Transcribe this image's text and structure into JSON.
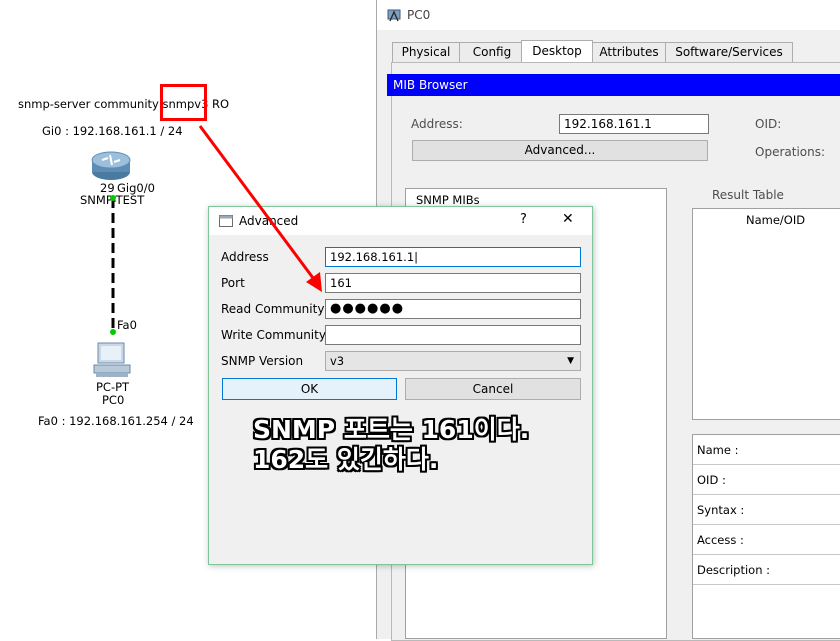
{
  "topology": {
    "server_command": "snmp-server community snmpv3 RO",
    "router_ip": "Gi0 : 192.168.161.1 / 24",
    "router_port_number": "29",
    "router_port_name": "Gig0/0",
    "router_name": "SNMP-TEST",
    "pc_port": "Fa0",
    "pc_type": "PC-PT",
    "pc_name": "PC0",
    "pc_ip": "Fa0 : 192.168.161.254 / 24"
  },
  "pc_window": {
    "title": "PC0",
    "tabs": [
      {
        "label": "Physical"
      },
      {
        "label": "Config"
      },
      {
        "label": "Desktop"
      },
      {
        "label": "Attributes"
      },
      {
        "label": "Software/Services"
      }
    ],
    "active_tab": "Desktop",
    "mib_browser": {
      "title": "MIB Browser",
      "address_label": "Address:",
      "address_value": "192.168.161.1",
      "oid_label": "OID:",
      "operations_label": "Operations:",
      "advanced_button": "Advanced...",
      "snmp_mibs_title": "SNMP MIBs",
      "result_table_label": "Result Table",
      "name_oid_header": "Name/OID",
      "details": [
        {
          "label": "Name :"
        },
        {
          "label": "OID :"
        },
        {
          "label": "Syntax :"
        },
        {
          "label": "Access :"
        },
        {
          "label": "Description :"
        }
      ]
    }
  },
  "advanced_dialog": {
    "title": "Advanced",
    "help_glyph": "?",
    "close_glyph": "✕",
    "address_label": "Address",
    "address_value": "192.168.161.1|",
    "port_label": "Port",
    "port_value": "161",
    "read_community_label": "Read Community",
    "read_community_masked": "●●●●●●",
    "write_community_label": "Write Community",
    "write_community_value": "",
    "snmp_version_label": "SNMP Version",
    "snmp_version_value": "v3",
    "ok_button": "OK",
    "cancel_button": "Cancel"
  },
  "annotation": {
    "line1": "SNMP 포트는 161이다.",
    "line2": "162도 있긴하다."
  },
  "colors": {
    "mib_title_bg": "#0000ff",
    "highlight_box": "#ff0000",
    "arrow": "#ff0000",
    "link_dot": "#00cc00",
    "dialog_border": "#7fc59a",
    "ok_border": "#0078d7"
  }
}
